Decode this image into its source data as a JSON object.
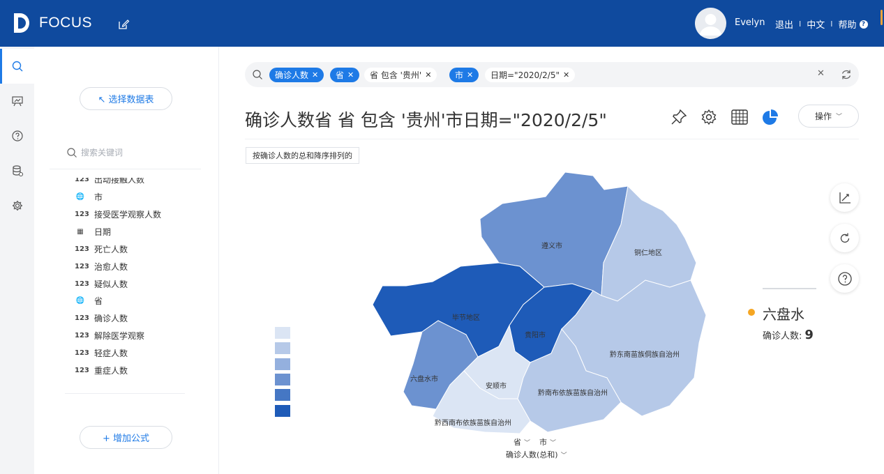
{
  "app": {
    "name": "FOCUS",
    "user": "Evelyn",
    "links": [
      "退出",
      "中文",
      "帮助"
    ]
  },
  "panel": {
    "select_table": "↖ 选择数据表",
    "search_placeholder": "搜索关键词",
    "fields": [
      {
        "icon": "number-icon",
        "label": "出动接触人数"
      },
      {
        "icon": "globe-icon",
        "label": "市"
      },
      {
        "icon": "number-icon",
        "label": "接受医学观察人数"
      },
      {
        "icon": "calendar-icon",
        "label": "日期"
      },
      {
        "icon": "number-icon",
        "label": "死亡人数"
      },
      {
        "icon": "number-icon",
        "label": "治愈人数"
      },
      {
        "icon": "number-icon",
        "label": "疑似人数"
      },
      {
        "icon": "globe-icon",
        "label": "省"
      },
      {
        "icon": "number-icon",
        "label": "确诊人数"
      },
      {
        "icon": "number-icon",
        "label": "解除医学观察"
      },
      {
        "icon": "number-icon",
        "label": "轻症人数"
      },
      {
        "icon": "number-icon",
        "label": "重症人数"
      }
    ],
    "add_formula": "+ 增加公式"
  },
  "searchbar": {
    "chips": [
      {
        "text": "确诊人数",
        "style": "blue"
      },
      {
        "text": "省",
        "style": "blue"
      },
      {
        "text": "省 包含 '贵州'",
        "style": "plain"
      },
      {
        "text": "市",
        "style": "blue"
      },
      {
        "text": "日期=\"2020/2/5\"",
        "style": "plain"
      }
    ]
  },
  "main": {
    "title": "确诊人数省 省 包含 '贵州'市日期=\"2020/2/5\"",
    "operate_label": "操作",
    "sort_tag": "按确诊人数的总和降序排列的",
    "axis_province": "省",
    "axis_city": "市",
    "axis_metric": "确诊人数(总和)"
  },
  "tooltip": {
    "name": "六盘水",
    "metric_label": "确诊人数:",
    "value": "9"
  },
  "colors": {
    "brand": "#0f4a9e",
    "accent": "#1e7ae6",
    "legend": [
      "#dbe5f4",
      "#b6c9e8",
      "#94b0de",
      "#6c92d0",
      "#4577c4",
      "#1e5bb8"
    ]
  },
  "chart_data": {
    "type": "choropleth-map",
    "regions": [
      {
        "name": "遵义市",
        "shade": 3
      },
      {
        "name": "铜仁地区",
        "shade": 1
      },
      {
        "name": "毕节地区",
        "shade": 5
      },
      {
        "name": "贵阳市",
        "shade": 5
      },
      {
        "name": "黔东南苗族侗族自治州",
        "shade": 1
      },
      {
        "name": "六盘水市",
        "shade": 3
      },
      {
        "name": "安顺市",
        "shade": 0
      },
      {
        "name": "黔南布依族苗族自治州",
        "shade": 1
      },
      {
        "name": "黔西南布依族苗族自治州",
        "shade": 0
      }
    ]
  }
}
